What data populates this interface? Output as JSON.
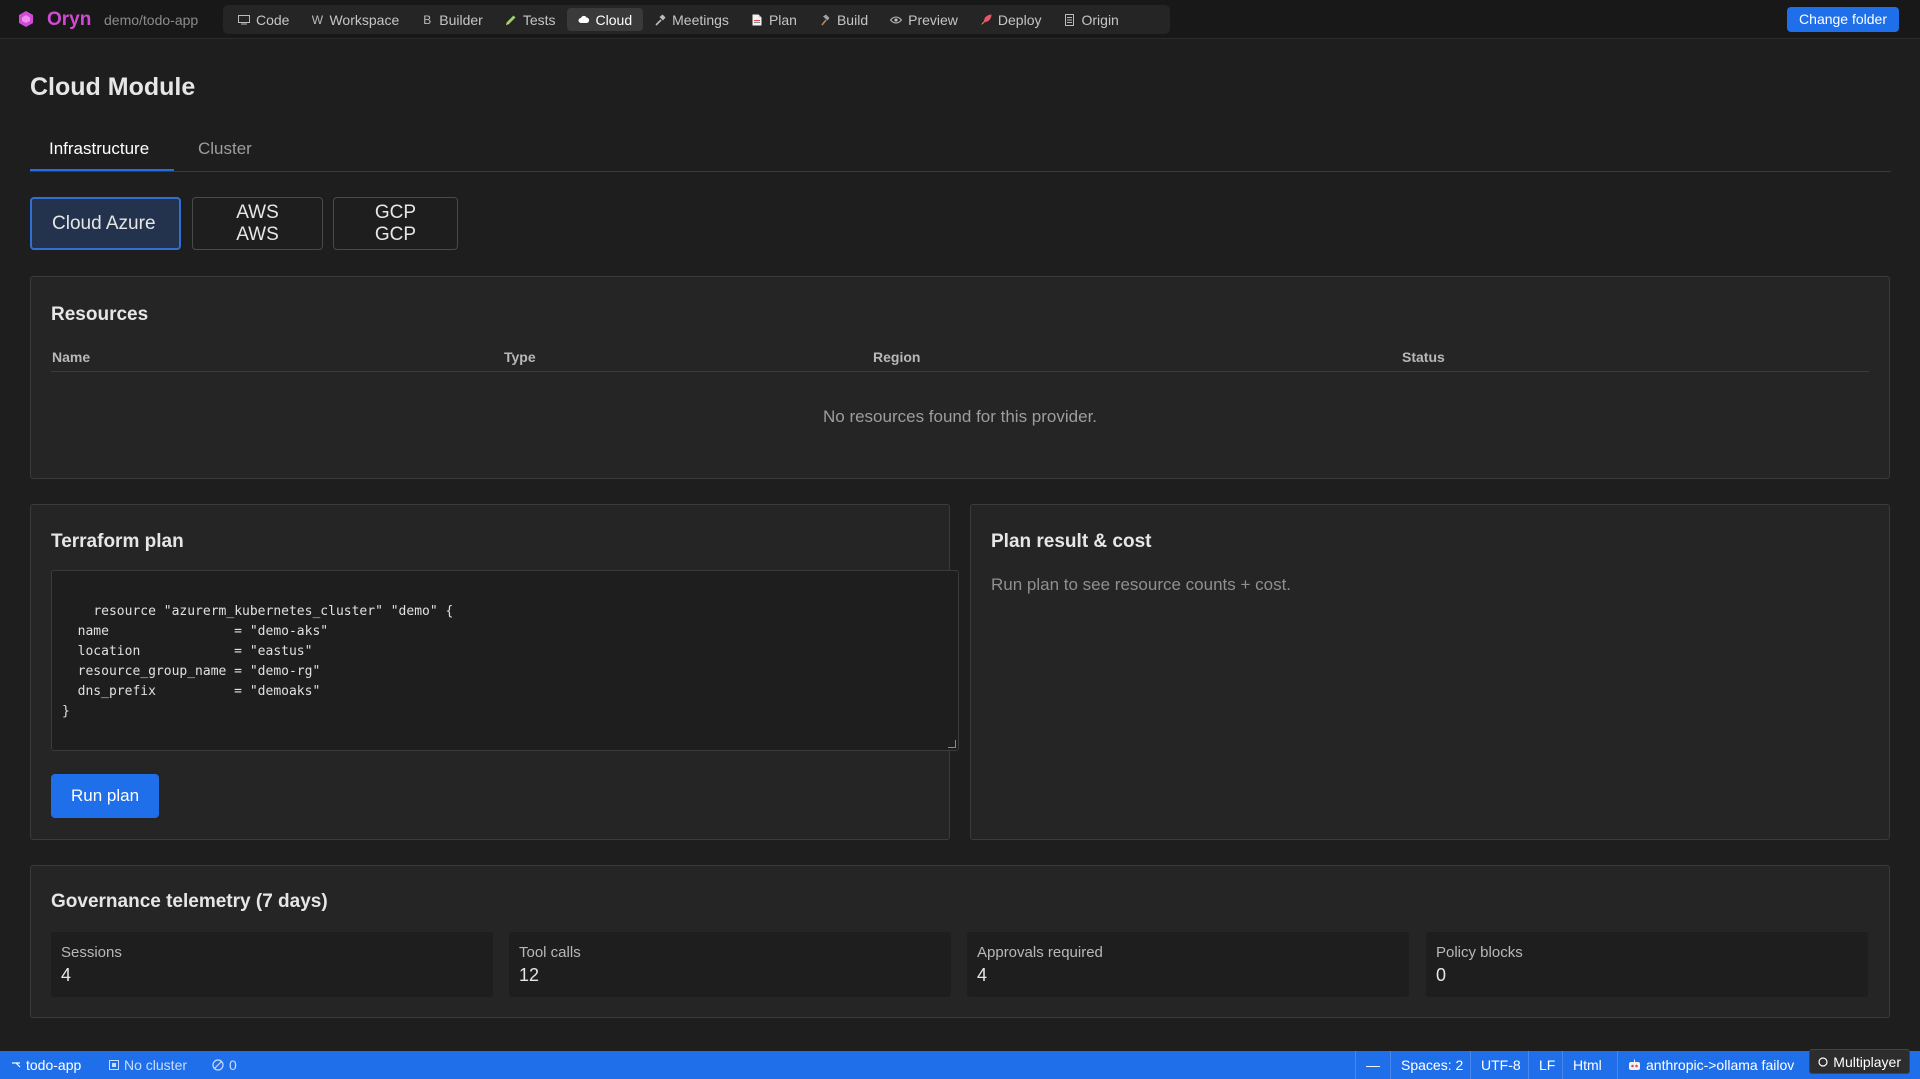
{
  "app": {
    "brand": "Oryn",
    "repo": "demo/todo-app",
    "change_folder": "Change folder"
  },
  "nav": {
    "tabs": [
      {
        "label": "Code",
        "icon": "monitor-icon"
      },
      {
        "label": "Workspace",
        "icon": "w-letter-icon",
        "glyph": "W"
      },
      {
        "label": "Builder",
        "icon": "b-letter-icon",
        "glyph": "B"
      },
      {
        "label": "Tests",
        "icon": "pencil-icon"
      },
      {
        "label": "Cloud",
        "icon": "cloud-icon",
        "active": true
      },
      {
        "label": "Meetings",
        "icon": "hammer-icon"
      },
      {
        "label": "Plan",
        "icon": "document-icon"
      },
      {
        "label": "Build",
        "icon": "hammer-icon"
      },
      {
        "label": "Preview",
        "icon": "eye-icon"
      },
      {
        "label": "Deploy",
        "icon": "rocket-icon"
      },
      {
        "label": "Origin",
        "icon": "file-icon"
      }
    ]
  },
  "page": {
    "title": "Cloud Module",
    "tabs": [
      {
        "label": "Infrastructure",
        "active": true
      },
      {
        "label": "Cluster"
      }
    ],
    "providers": [
      {
        "label": "Cloud Azure",
        "active": true
      },
      {
        "label": "AWS AWS"
      },
      {
        "label": "GCP GCP"
      }
    ]
  },
  "resources": {
    "title": "Resources",
    "columns": [
      "Name",
      "Type",
      "Region",
      "Status"
    ],
    "empty": "No resources found for this provider."
  },
  "terraform": {
    "title": "Terraform plan",
    "code": "resource \"azurerm_kubernetes_cluster\" \"demo\" {\n  name                = \"demo-aks\"\n  location            = \"eastus\"\n  resource_group_name = \"demo-rg\"\n  dns_prefix          = \"demoaks\"\n}",
    "run_label": "Run plan"
  },
  "plan_result": {
    "title": "Plan result & cost",
    "hint": "Run plan to see resource counts + cost."
  },
  "governance": {
    "title": "Governance telemetry (7 days)",
    "stats": [
      {
        "label": "Sessions",
        "value": "4"
      },
      {
        "label": "Tool calls",
        "value": "12"
      },
      {
        "label": "Approvals required",
        "value": "4"
      },
      {
        "label": "Policy blocks",
        "value": "0"
      }
    ]
  },
  "statusbar": {
    "branch": "todo-app",
    "cluster": "No cluster",
    "problems": "0",
    "dash": "—",
    "spaces": "Spaces: 2",
    "encoding": "UTF-8",
    "eol": "LF",
    "language": "Html",
    "model": "anthropic->ollama failov",
    "multiplayer": "Multiplayer"
  },
  "colors": {
    "accent": "#1f6feb",
    "brand": "#d14ad4",
    "background": "#1e1e1e",
    "card": "#252526"
  }
}
